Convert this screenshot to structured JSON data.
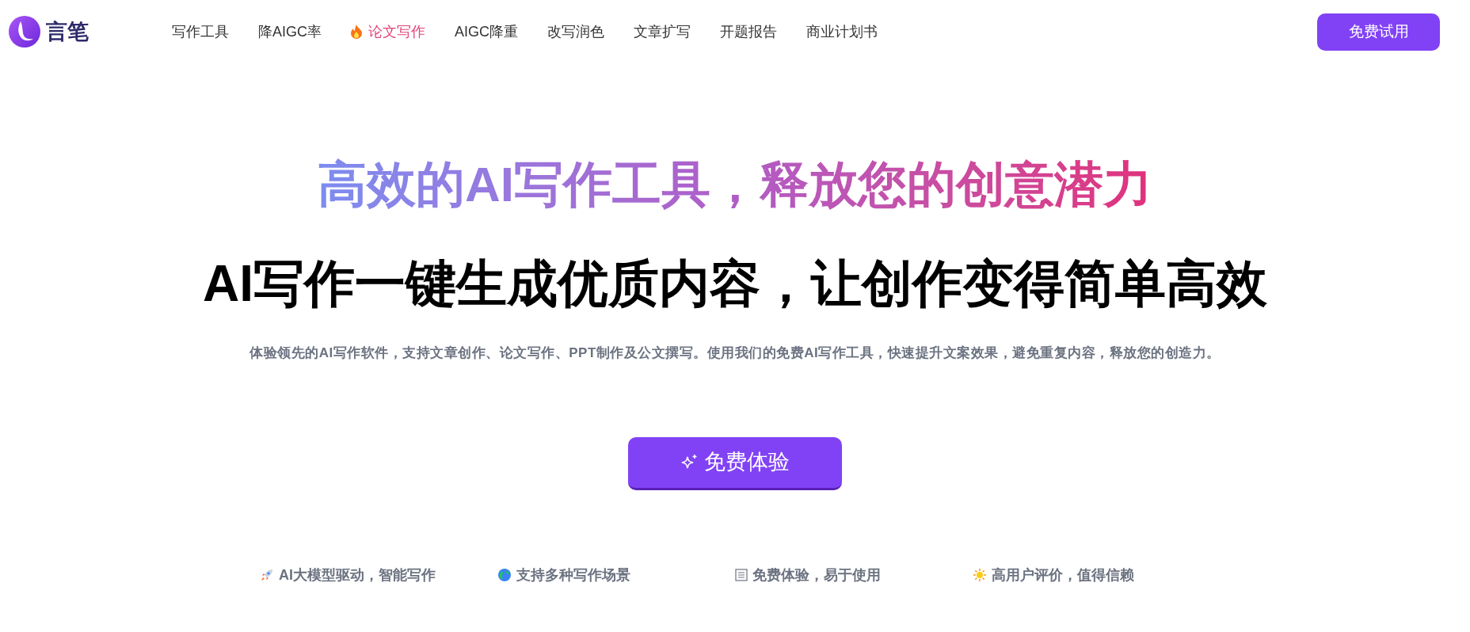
{
  "brand": {
    "name": "言笔"
  },
  "nav": [
    {
      "label": "写作工具",
      "selected": false
    },
    {
      "label": "降AIGC率",
      "selected": false
    },
    {
      "label": "论文写作",
      "selected": true
    },
    {
      "label": "AIGC降重",
      "selected": false
    },
    {
      "label": "改写润色",
      "selected": false
    },
    {
      "label": "文章扩写",
      "selected": false
    },
    {
      "label": "开题报告",
      "selected": false
    },
    {
      "label": "商业计划书",
      "selected": false
    }
  ],
  "trial_button": "免费试用",
  "hero": {
    "headline": "高效的AI写作工具，释放您的创意潜力",
    "subheadline": "AI写作一键生成优质内容，让创作变得简单高效",
    "description": "体验领先的AI写作软件，支持文章创作、论文写作、PPT制作及公文撰写。使用我们的免费AI写作工具，快速提升文案效果，避免重复内容，释放您的创造力。",
    "cta": "免费体验"
  },
  "features": [
    {
      "kind": "rocket",
      "label": "AI大模型驱动，智能写作"
    },
    {
      "kind": "globe",
      "label": "支持多种写作场景"
    },
    {
      "kind": "missing-glyph",
      "label": "免费体验，易于使用"
    },
    {
      "kind": "sun",
      "label": "高用户评价，值得信赖"
    }
  ]
}
